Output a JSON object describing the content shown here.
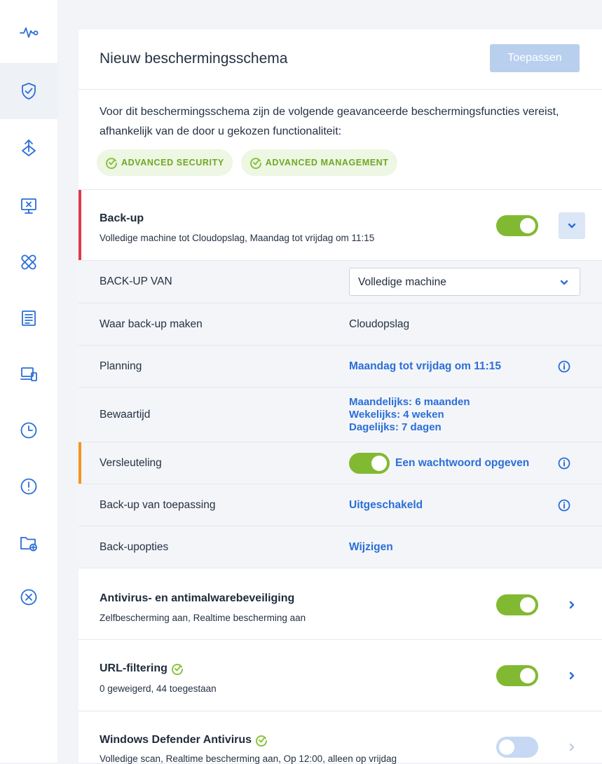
{
  "rail": {
    "items": [
      {
        "icon": "pulse-icon"
      },
      {
        "icon": "shield-check-icon",
        "active": true
      },
      {
        "icon": "deploy-arrows-icon"
      },
      {
        "icon": "monitor-x-icon"
      },
      {
        "icon": "bandage-icon"
      },
      {
        "icon": "report-icon"
      },
      {
        "icon": "devices-icon"
      },
      {
        "icon": "clock-icon"
      },
      {
        "icon": "alert-icon"
      },
      {
        "icon": "folder-add-icon"
      },
      {
        "icon": "close-circle-icon"
      }
    ]
  },
  "header": {
    "title": "Nieuw beschermingsschema",
    "apply_label": "Toepassen"
  },
  "notice": {
    "text": "Voor dit beschermingsschema zijn de volgende geavanceerde beschermingsfuncties vereist, afhankelijk van de door u gekozen functionaliteit:",
    "badges": [
      "ADVANCED SECURITY",
      "ADVANCED MANAGEMENT"
    ]
  },
  "backup": {
    "title": "Back-up",
    "subtitle": "Volledige machine tot Cloudopslag, Maandag tot vrijdag om 11:15",
    "enabled": true,
    "rows": {
      "source": {
        "label": "BACK-UP VAN",
        "value": "Volledige machine"
      },
      "destination": {
        "label": "Waar back-up maken",
        "value": "Cloudopslag"
      },
      "schedule": {
        "label": "Planning",
        "value": "Maandag tot vrijdag om 11:15"
      },
      "retention": {
        "label": "Bewaartijd",
        "monthly": "Maandelijks: 6 maanden",
        "weekly": "Wekelijks: 4 weken",
        "daily": "Dagelijks: 7 dagen"
      },
      "encryption": {
        "label": "Versleuteling",
        "value": "Een wachtwoord opgeven",
        "enabled": true
      },
      "app_backup": {
        "label": "Back-up van toepassing",
        "value": "Uitgeschakeld"
      },
      "options": {
        "label": "Back-upopties",
        "value": "Wijzigen"
      }
    }
  },
  "sections": {
    "antivirus": {
      "title": "Antivirus- en antimalwarebeveiliging",
      "subtitle": "Zelfbescherming aan, Realtime bescherming aan",
      "enabled": true
    },
    "url": {
      "title": "URL-filtering",
      "subtitle": "0 geweigerd, 44 toegestaan",
      "enabled": true
    },
    "defender": {
      "title": "Windows Defender Antivirus",
      "subtitle": "Volledige scan, Realtime bescherming aan, Op 12:00, alleen op vrijdag",
      "enabled": false
    }
  },
  "colors": {
    "accent": "#2b6ed8",
    "toggle_on": "#82b932",
    "toggle_off": "#c6d8f3",
    "badge_text": "#6ea924",
    "error_bar": "#e2394b",
    "warning_bar": "#f5941f"
  }
}
